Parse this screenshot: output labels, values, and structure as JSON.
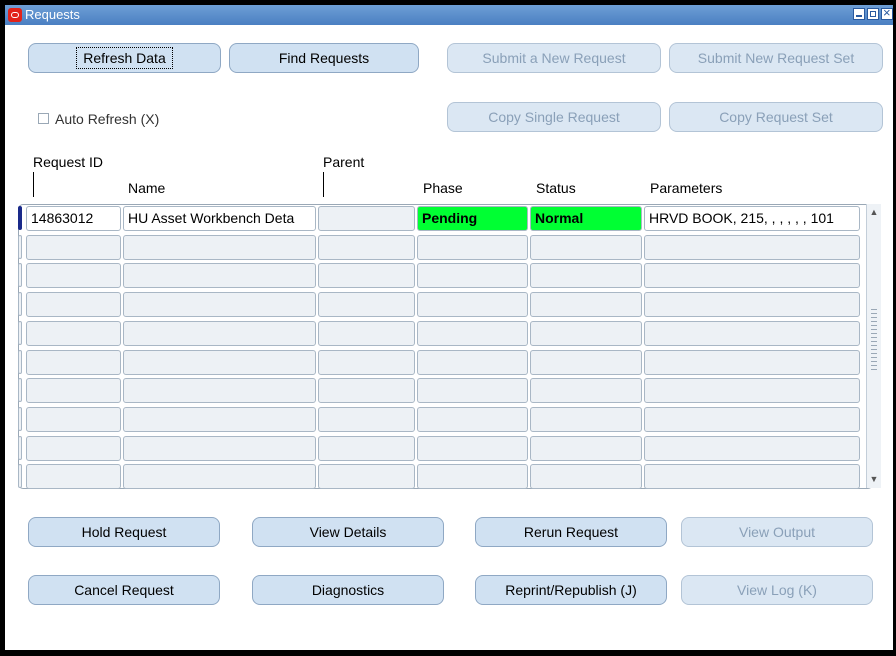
{
  "window": {
    "title": "Requests"
  },
  "top_buttons": {
    "refresh": "Refresh Data",
    "find": "Find Requests",
    "submit_new": "Submit a New Request",
    "submit_set": "Submit New Request Set",
    "copy_single": "Copy Single Request",
    "copy_set": "Copy Request Set"
  },
  "auto_refresh": {
    "label": "Auto Refresh (X)",
    "checked": false
  },
  "columns": {
    "request_id": "Request ID",
    "parent": "Parent",
    "name": "Name",
    "phase": "Phase",
    "status": "Status",
    "parameters": "Parameters"
  },
  "rows": [
    {
      "request_id": "14863012",
      "name": "HU Asset Workbench Deta",
      "parent": "",
      "phase": "Pending",
      "status": "Normal",
      "parameters": "HRVD BOOK, 215, , , , , , 101"
    }
  ],
  "bottom_buttons": {
    "hold": "Hold Request",
    "view_details": "View Details",
    "rerun": "Rerun Request",
    "view_output": "View Output",
    "cancel": "Cancel Request",
    "diagnostics": "Diagnostics",
    "reprint": "Reprint/Republish (J)",
    "view_log": "View Log (K)"
  },
  "colors": {
    "phase_status_highlight": "#00ff33",
    "titlebar": "#4a7fc2",
    "button": "#d0e1f2"
  }
}
